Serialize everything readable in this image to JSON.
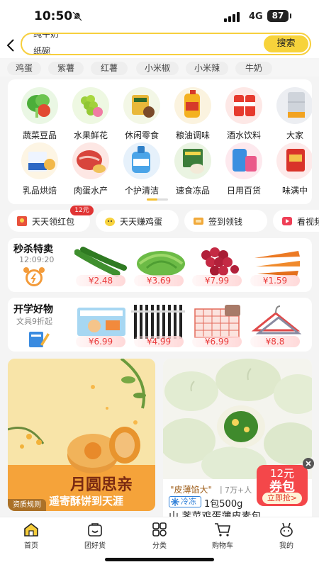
{
  "status_bar": {
    "time": "10:50",
    "network": "4G",
    "battery": "87"
  },
  "search": {
    "line1": "纯牛奶",
    "line2": "纸碗",
    "button_label": "搜索"
  },
  "hot_searches": [
    "鸡蛋",
    "紫薯",
    "红薯",
    "小米椒",
    "小米辣",
    "牛奶"
  ],
  "categories": [
    {
      "label": "蔬菜豆品",
      "icon": "vegetable-icon"
    },
    {
      "label": "水果鲜花",
      "icon": "fruit-icon"
    },
    {
      "label": "休闲零食",
      "icon": "snack-icon"
    },
    {
      "label": "粮油调味",
      "icon": "oil-icon"
    },
    {
      "label": "酒水饮料",
      "icon": "drink-icon"
    },
    {
      "label": "大家",
      "icon": "home-appliance-icon"
    },
    {
      "label": "乳品烘焙",
      "icon": "milk-icon"
    },
    {
      "label": "肉蛋水产",
      "icon": "meat-icon"
    },
    {
      "label": "个护清洁",
      "icon": "cleaning-icon"
    },
    {
      "label": "速食冻品",
      "icon": "frozen-food-icon"
    },
    {
      "label": "日用百货",
      "icon": "daily-goods-icon"
    },
    {
      "label": "味满中",
      "icon": "gift-box-icon"
    }
  ],
  "promos": [
    {
      "label": "天天领红包",
      "badge": "12元"
    },
    {
      "label": "天天赚鸡蛋"
    },
    {
      "label": "签到领钱"
    },
    {
      "label": "看视频"
    }
  ],
  "flash_sale": {
    "title": "秒杀特卖",
    "countdown": "12:09:20",
    "items": [
      {
        "name": "cucumber",
        "price": "¥2.48"
      },
      {
        "name": "lettuce",
        "price": "¥3.69"
      },
      {
        "name": "grapes",
        "price": "¥7.99"
      },
      {
        "name": "carrot",
        "price": "¥1.59"
      }
    ]
  },
  "school": {
    "title": "开学好物",
    "subtitle": "文具9折起",
    "items": [
      {
        "name": "stationery-box",
        "price": "¥6.99"
      },
      {
        "name": "gel-pens",
        "price": "¥4.99"
      },
      {
        "name": "grid-notebook",
        "price": "¥6.99"
      },
      {
        "name": "hangers",
        "price": "¥8.8"
      }
    ]
  },
  "banner_left": {
    "title": "月圆思亲",
    "subtitle": "遥寄酥饼到天涯",
    "tag": "资质规则"
  },
  "product_card": {
    "ribbon": "\"皮薄馅大\"",
    "sales": "7万+人",
    "frozen_tag": "冷冻",
    "spec": "1包500g",
    "name": "山 荠菜鸡蛋薄皮素包",
    "coupon_amount": "12元",
    "coupon_word": "券包",
    "coupon_button": "立即抢>"
  },
  "bottom_nav": [
    {
      "label": "首页",
      "icon": "home-icon"
    },
    {
      "label": "团好货",
      "icon": "group-buy-icon"
    },
    {
      "label": "分类",
      "icon": "category-icon"
    },
    {
      "label": "购物车",
      "icon": "cart-icon"
    },
    {
      "label": "我的",
      "icon": "profile-icon"
    }
  ],
  "colors": {
    "accent": "#f7d33b",
    "price": "#e93a3a",
    "frozen": "#2e7fd8"
  }
}
